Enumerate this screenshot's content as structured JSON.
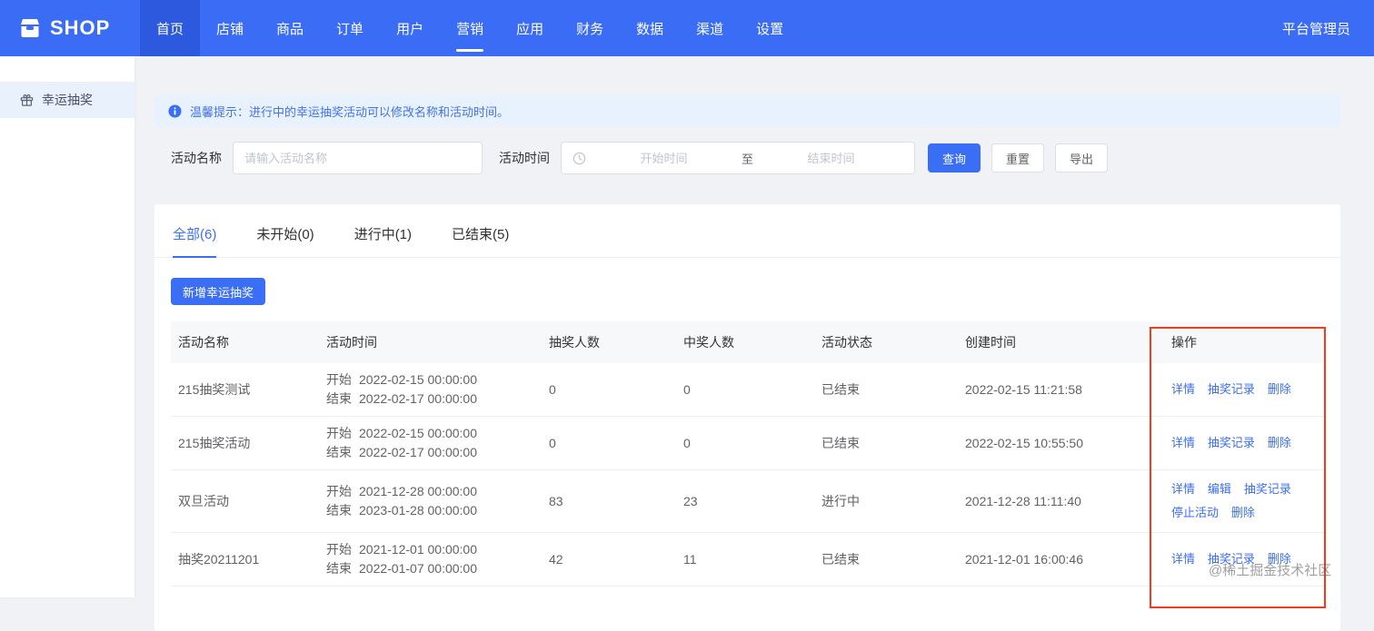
{
  "navbar": {
    "logo": "SHOP",
    "items": [
      "首页",
      "店铺",
      "商品",
      "订单",
      "用户",
      "营销",
      "应用",
      "财务",
      "数据",
      "渠道",
      "设置"
    ],
    "user": "平台管理员"
  },
  "sidebar": {
    "items": [
      {
        "label": "幸运抽奖",
        "icon": "gift-icon"
      }
    ]
  },
  "alert": {
    "icon": "info-icon",
    "text": "温馨提示：进行中的幸运抽奖活动可以修改名称和活动时间。"
  },
  "filters": {
    "name_label": "活动名称",
    "name_placeholder": "请输入活动名称",
    "name_value": "",
    "time_label": "活动时间",
    "time_icon": "clock-icon",
    "start_placeholder": "开始时间",
    "separator": "至",
    "end_placeholder": "结束时间",
    "search_button": "查询",
    "reset_button": "重置",
    "export_button": "导出"
  },
  "tabs": [
    {
      "label": "全部(6)",
      "active": true
    },
    {
      "label": "未开始(0)",
      "active": false
    },
    {
      "label": "进行中(1)",
      "active": false
    },
    {
      "label": "已结束(5)",
      "active": false
    }
  ],
  "add_button": "新增幸运抽奖",
  "table": {
    "headers": [
      "活动名称",
      "活动时间",
      "抽奖人数",
      "中奖人数",
      "活动状态",
      "创建时间",
      "操作"
    ],
    "time_start_label": "开始",
    "time_end_label": "结束",
    "rows": [
      {
        "name": "215抽奖测试",
        "start": "2022-02-15 00:00:00",
        "end": "2022-02-17 00:00:00",
        "draw_count": "0",
        "win_count": "0",
        "status": "已结束",
        "created": "2022-02-15 11:21:58",
        "actions": [
          "详情",
          "抽奖记录",
          "删除"
        ]
      },
      {
        "name": "215抽奖活动",
        "start": "2022-02-15 00:00:00",
        "end": "2022-02-17 00:00:00",
        "draw_count": "0",
        "win_count": "0",
        "status": "已结束",
        "created": "2022-02-15 10:55:50",
        "actions": [
          "详情",
          "抽奖记录",
          "删除"
        ]
      },
      {
        "name": "双旦活动",
        "start": "2021-12-28 00:00:00",
        "end": "2023-01-28 00:00:00",
        "draw_count": "83",
        "win_count": "23",
        "status": "进行中",
        "created": "2021-12-28 11:11:40",
        "actions": [
          "详情",
          "编辑",
          "抽奖记录",
          "停止活动",
          "删除"
        ]
      },
      {
        "name": "抽奖20211201",
        "start": "2021-12-01 00:00:00",
        "end": "2022-01-07 00:00:00",
        "draw_count": "42",
        "win_count": "11",
        "status": "已结束",
        "created": "2021-12-01 16:00:46",
        "actions": [
          "详情",
          "抽奖记录",
          "删除"
        ]
      }
    ]
  },
  "watermark": "@稀土掘金技术社区",
  "colors": {
    "navbar_bg": "#3a6cf6",
    "navbar_active_bg": "#2c59dd",
    "primary": "#3a6ef5",
    "alert_bg": "#e8f1fe",
    "alert_text": "#4273e8",
    "sidebar_active_bg": "#e9f1fd",
    "table_header_bg": "#f7f8fa",
    "annotation_red": "#f53b1e"
  }
}
